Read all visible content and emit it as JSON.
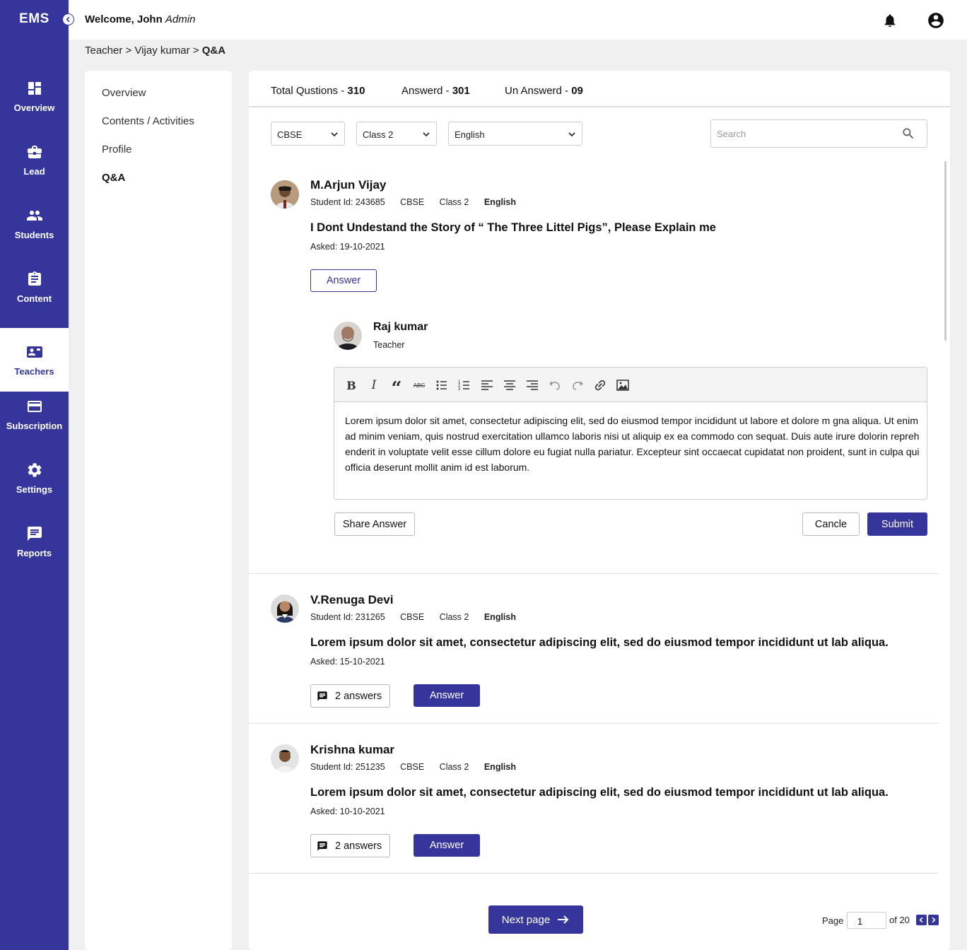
{
  "app": {
    "brand": "EMS"
  },
  "header": {
    "welcome_prefix": "Welcome, John",
    "role": "Admin"
  },
  "breadcrumb": {
    "part1": "Teacher",
    "sep": ">",
    "part2": "Vijay kumar",
    "current": "Q&A"
  },
  "sidebar": {
    "items": [
      {
        "label": "Overview",
        "icon": "dashboard-icon"
      },
      {
        "label": "Lead",
        "icon": "briefcase-icon"
      },
      {
        "label": "Students",
        "icon": "people-icon"
      },
      {
        "label": "Content",
        "icon": "clipboard-icon"
      },
      {
        "label": "Teachers",
        "icon": "contact-card-icon",
        "active": true
      },
      {
        "label": "Subscription",
        "icon": "card-icon"
      },
      {
        "label": "Settings",
        "icon": "gear-icon"
      },
      {
        "label": "Reports",
        "icon": "chat-icon"
      }
    ]
  },
  "subnav": [
    "Overview",
    "Contents / Activities",
    "Profile",
    "Q&A"
  ],
  "stats": {
    "total_label": "Total Qustions - ",
    "total_value": "310",
    "answered_label": "Answerd - ",
    "answered_value": "301",
    "unanswered_label": "Un Answerd - ",
    "unanswered_value": "09"
  },
  "filters": {
    "board": "CBSE",
    "class": "Class 2",
    "subject": "English"
  },
  "search": {
    "placeholder": "Search"
  },
  "questions": [
    {
      "name": "M.Arjun Vijay",
      "student_id": "Student Id: 243685",
      "board": "CBSE",
      "class": "Class 2",
      "subject": "English",
      "text": "I Dont Undestand the Story of “ The Three Littel Pigs”, Please Explain me",
      "asked": "Asked: 19-10-2021",
      "answer_label": "Answer"
    },
    {
      "name": "V.Renuga Devi",
      "student_id": "Student Id: 231265",
      "board": "CBSE",
      "class": "Class 2",
      "subject": "English",
      "text": "Lorem ipsum dolor sit amet, consectetur adipiscing elit, sed do eiusmod tempor incididunt ut lab aliqua.",
      "asked": "Asked: 15-10-2021",
      "answers_count": "2 answers",
      "answer_label": "Answer"
    },
    {
      "name": "Krishna kumar",
      "student_id": "Student Id: 251235",
      "board": "CBSE",
      "class": "Class 2",
      "subject": "English",
      "text": "Lorem ipsum dolor sit amet, consectetur adipiscing elit, sed do eiusmod tempor incididunt ut lab aliqua.",
      "asked": "Asked: 10-10-2021",
      "answers_count": "2 answers",
      "answer_label": "Answer"
    }
  ],
  "reply": {
    "teacher_name": "Raj kumar",
    "teacher_role": "Teacher",
    "text": "Lorem ipsum dolor sit amet, consectetur adipiscing elit, sed do eiusmod tempor incididunt ut labore et dolore m gna aliqua. Ut enim ad minim veniam, quis nostrud exercitation ullamco laboris nisi ut aliquip ex ea commodo con sequat. Duis aute irure dolorin reprehenderit in voluptate velit esse cillum dolore eu fugiat nulla pariatur. Excepteur  sint occaecat cupidatat non proident, sunt in culpa qui officia deserunt mollit anim id est laborum.",
    "share_label": "Share Answer",
    "cancel_label": "Cancle",
    "submit_label": "Submit"
  },
  "pagination": {
    "next_label": "Next page",
    "page_label": "Page",
    "page_value": "1",
    "of_label": "of 20"
  },
  "colors": {
    "primary": "#35359c",
    "background": "#f0f0f0"
  }
}
